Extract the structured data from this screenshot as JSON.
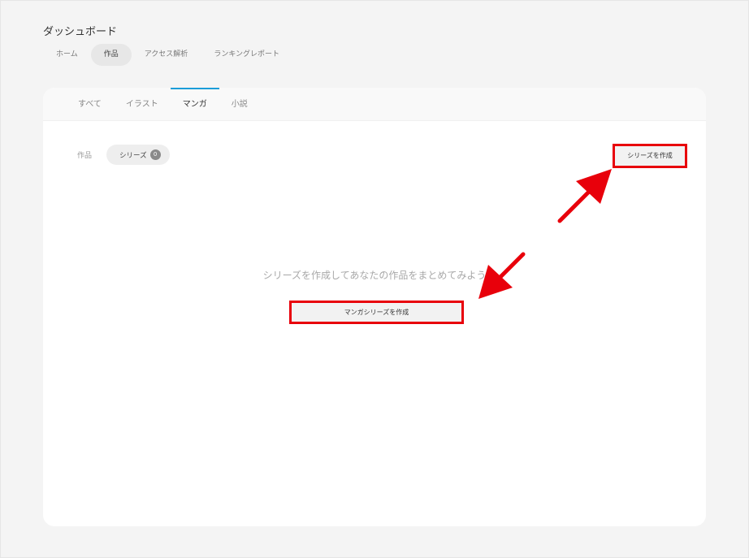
{
  "header": {
    "title": "ダッシュボード",
    "tabs": [
      {
        "label": "ホーム"
      },
      {
        "label": "作品"
      },
      {
        "label": "アクセス解析"
      },
      {
        "label": "ランキングレポート"
      }
    ],
    "active_tab": "作品"
  },
  "card": {
    "tabs": [
      {
        "label": "すべて"
      },
      {
        "label": "イラスト"
      },
      {
        "label": "マンガ"
      },
      {
        "label": "小説"
      }
    ],
    "active_tab": "マンガ",
    "filter": {
      "works_label": "作品",
      "series_label": "シリーズ",
      "series_count": "0"
    },
    "create_series_button": "シリーズを作成",
    "empty_message": "シリーズを作成してあなたの作品をまとめてみよう",
    "create_manga_series_button": "マンガシリーズを作成"
  },
  "colors": {
    "accent": "#1a9dd8",
    "annotation_red": "#e8000b",
    "background": "#f4f4f4"
  },
  "icons": [
    "arrow-annotation-icon"
  ]
}
